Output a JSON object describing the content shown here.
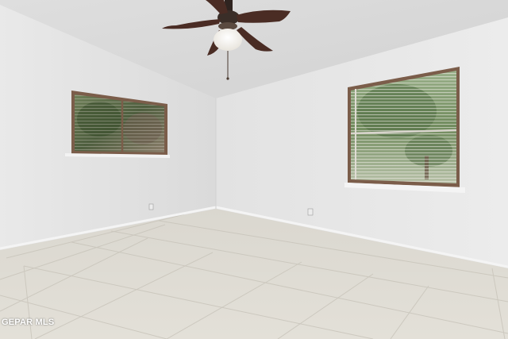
{
  "watermark": {
    "text": "GEPAR MLS"
  }
}
